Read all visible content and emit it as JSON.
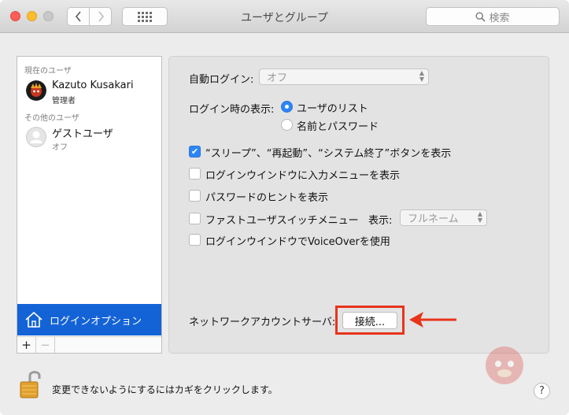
{
  "window": {
    "title": "ユーザとグループ",
    "search_placeholder": "検索"
  },
  "sidebar": {
    "current_users_label": "現在のユーザ",
    "current_user": {
      "name": "Kazuto Kusakari",
      "role": "管理者"
    },
    "other_users_label": "その他のユーザ",
    "guest_user": {
      "name": "ゲストユーザ",
      "status": "オフ"
    },
    "login_options_label": "ログインオプション",
    "add_label": "+",
    "remove_label": "−"
  },
  "options": {
    "auto_login_label": "自動ログイン:",
    "auto_login_value": "オフ",
    "login_display_label": "ログイン時の表示:",
    "radio_user_list": "ユーザのリスト",
    "radio_name_password": "名前とパスワード",
    "selected_display": "ユーザのリスト",
    "checkboxes": [
      {
        "label": "“スリープ”、“再起動”、“システム終了”ボタンを表示",
        "checked": true
      },
      {
        "label": "ログインウインドウに入力メニューを表示",
        "checked": false
      },
      {
        "label": "パスワードのヒントを表示",
        "checked": false
      },
      {
        "label": "ファストユーザスイッチメニュー",
        "checked": false
      },
      {
        "label": "ログインウインドウでVoiceOverを使用",
        "checked": false
      }
    ],
    "fast_switch_display_label": "表示:",
    "fast_switch_display_value": "フルネーム",
    "network_server_label": "ネットワークアカウントサーバ:",
    "connect_button": "接続..."
  },
  "footer": {
    "lock_text": "変更できないようにするにはカギをクリックします。",
    "help_label": "?"
  },
  "colors": {
    "selection_blue": "#1463d6",
    "control_blue": "#2d86f5",
    "annotation_red": "#e8341c"
  }
}
